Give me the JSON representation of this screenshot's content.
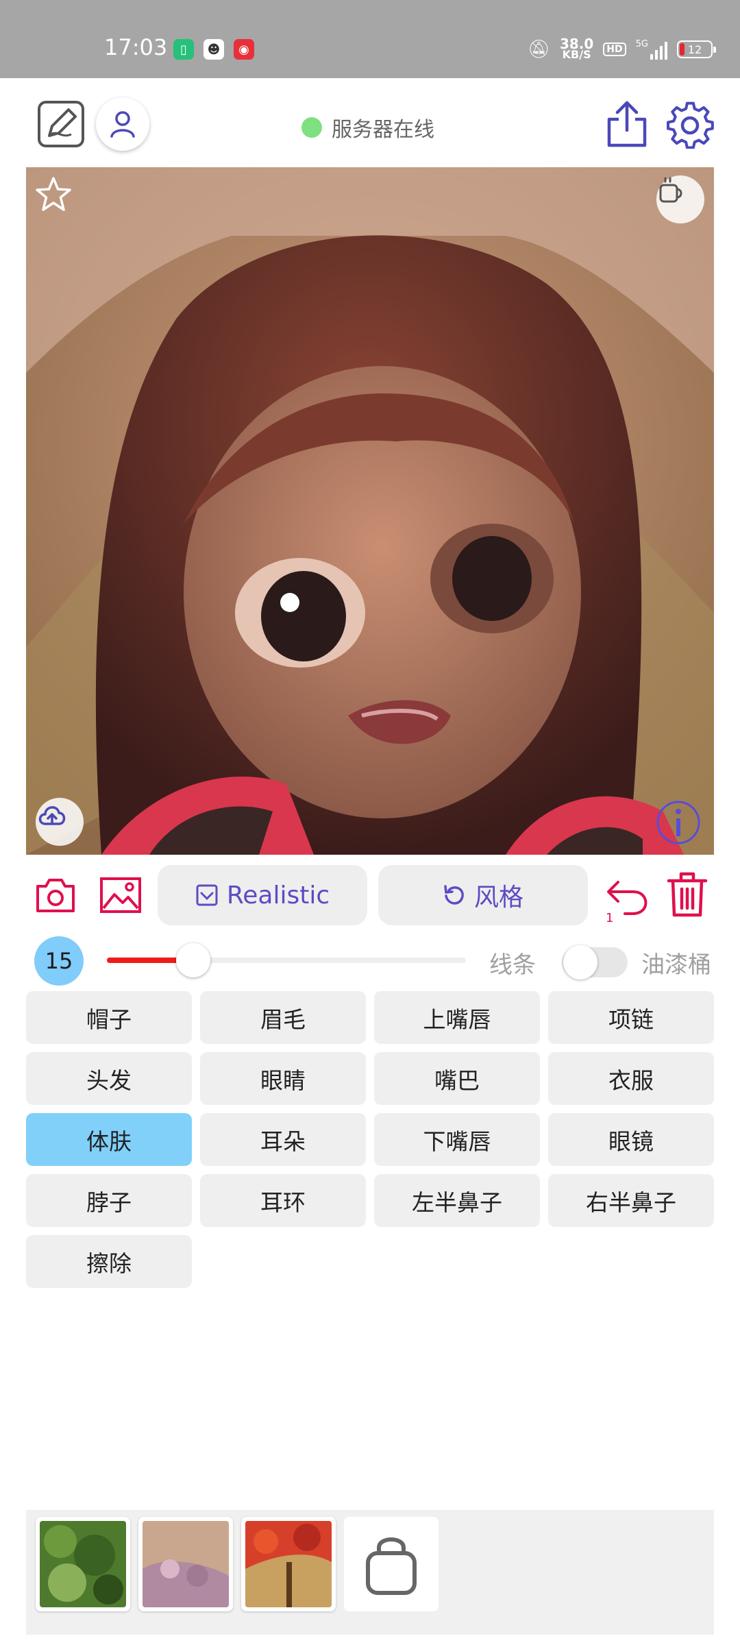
{
  "status_bar": {
    "time": "17:03",
    "speed_value": "38.0",
    "speed_unit": "KB/S",
    "hd": "HD",
    "network": "5G",
    "battery": "12"
  },
  "toolbar": {
    "server_status": "服务器在线"
  },
  "controls": {
    "model_label": "Realistic",
    "style_label": "风格",
    "undo_count": "1"
  },
  "brush": {
    "size": "15",
    "size_fraction": 0.24,
    "line_label": "线条",
    "bucket_label": "油漆桶",
    "bucket_enabled": false
  },
  "parts": [
    {
      "label": "帽子",
      "active": false
    },
    {
      "label": "眉毛",
      "active": false
    },
    {
      "label": "上嘴唇",
      "active": false
    },
    {
      "label": "项链",
      "active": false
    },
    {
      "label": "头发",
      "active": false
    },
    {
      "label": "眼睛",
      "active": false
    },
    {
      "label": "嘴巴",
      "active": false
    },
    {
      "label": "衣服",
      "active": false
    },
    {
      "label": "体肤",
      "active": true
    },
    {
      "label": "耳朵",
      "active": false
    },
    {
      "label": "下嘴唇",
      "active": false
    },
    {
      "label": "眼镜",
      "active": false
    },
    {
      "label": "脖子",
      "active": false
    },
    {
      "label": "耳环",
      "active": false
    },
    {
      "label": "左半鼻子",
      "active": false
    },
    {
      "label": "右半鼻子",
      "active": false
    },
    {
      "label": "擦除",
      "active": false
    }
  ],
  "colors": {
    "accent_purple": "#5b4cc4",
    "accent_red": "#e0104c",
    "active_part": "#80d0fa",
    "online": "#7ee07e"
  }
}
